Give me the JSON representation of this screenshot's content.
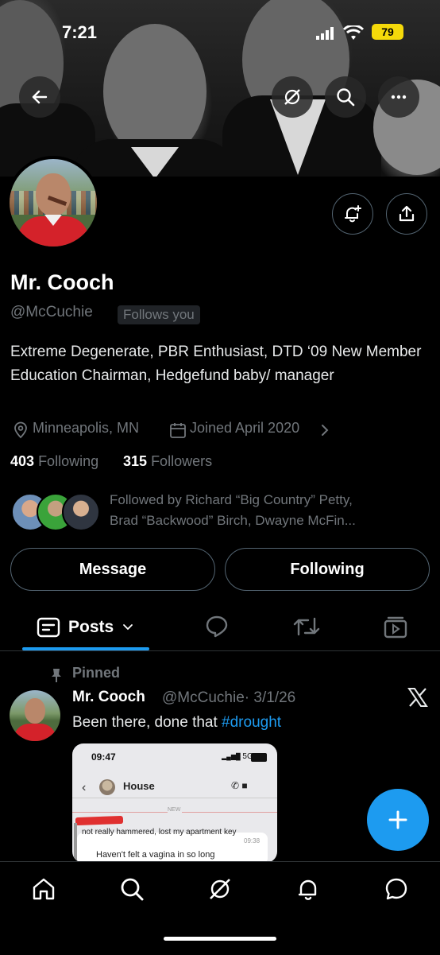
{
  "status": {
    "time": "7:21",
    "battery": "79"
  },
  "header": {
    "back_icon": "arrow-left-icon",
    "grok_icon": "grok-icon",
    "search_icon": "search-icon",
    "more_icon": "more-icon"
  },
  "profile": {
    "name": "Mr. Cooch",
    "handle": "@McCuchie",
    "follows_badge": "Follows you",
    "bio": "Extreme Degenerate, PBR Enthusiast, DTD ‘09 New Member Education Chairman, Hedgefund baby/ manager",
    "location": "Minneapolis, MN",
    "joined": "Joined April 2020",
    "following_count": "403",
    "following_label": "Following",
    "followers_count": "315",
    "followers_label": "Followers",
    "followed_by_line1": "Followed by Richard “Big Country” Petty,",
    "followed_by_line2": "Brad “Backwood” Birch, Dwayne McFin..."
  },
  "actions": {
    "message": "Message",
    "following": "Following"
  },
  "tabs": {
    "posts": "Posts"
  },
  "tweet": {
    "pinned": "Pinned",
    "name": "Mr. Cooch",
    "handle": "@McCuchie",
    "date": "· 3/1/26",
    "text": "Been there, done that ",
    "hashtag": "#drought",
    "shot": {
      "time": "09:47",
      "signal": "5G",
      "contact": "House",
      "new_label": "NEW",
      "msg1": "not really hammered, lost my apartment key",
      "msg1_time": "09:38",
      "msg2": "Haven't felt a vagina in so long"
    }
  },
  "colors": {
    "accent": "#1d9bf0",
    "muted": "#71767b",
    "border": "#536471"
  }
}
